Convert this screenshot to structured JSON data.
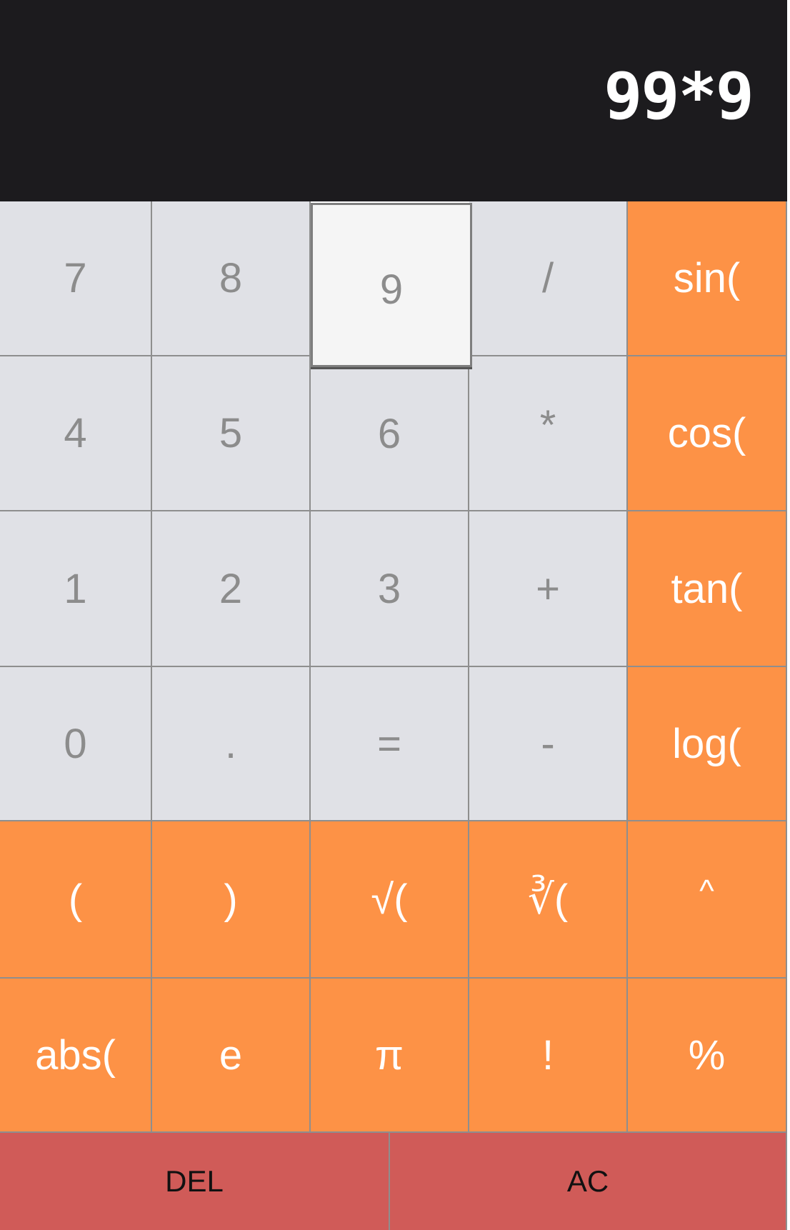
{
  "display": {
    "expression": "99*9"
  },
  "colors": {
    "display_bg": "#1c1b1e",
    "digit_key": "#e0e1e6",
    "function_key": "#fd9246",
    "clear_key": "#d05b58"
  },
  "keys": {
    "r0": [
      "7",
      "8",
      "9",
      "/",
      "sin("
    ],
    "r1": [
      "4",
      "5",
      "6",
      "*",
      "cos("
    ],
    "r2": [
      "1",
      "2",
      "3",
      "+",
      "tan("
    ],
    "r3": [
      "0",
      ".",
      "=",
      "-",
      "log("
    ],
    "r4": [
      "(",
      ")",
      "√(",
      "∛(",
      "^"
    ],
    "r5": [
      "abs(",
      "e",
      "π",
      "!",
      "%"
    ]
  },
  "bottom": {
    "del": "DEL",
    "ac": "AC"
  },
  "pressed_key": "9"
}
